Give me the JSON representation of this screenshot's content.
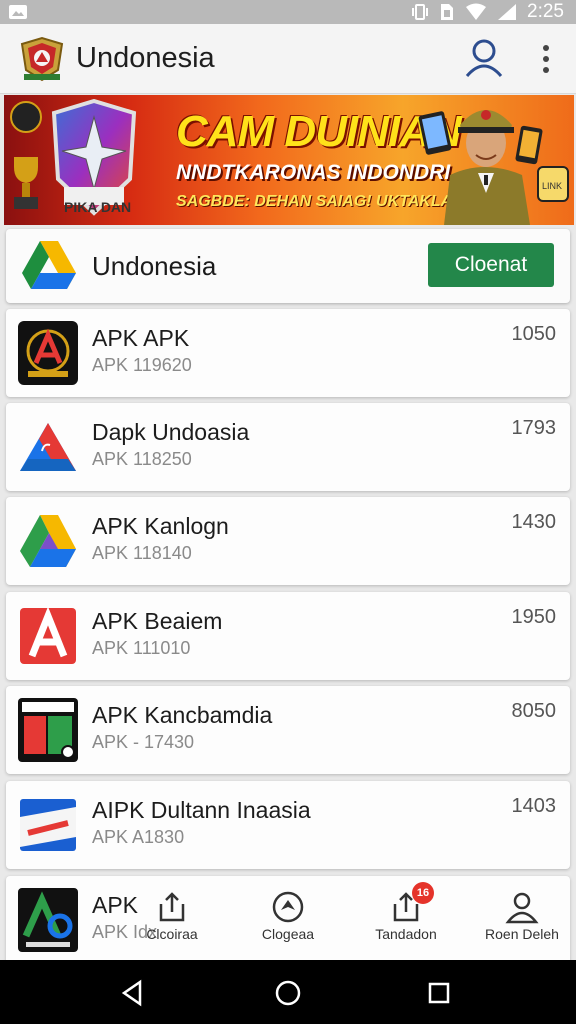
{
  "status_bar": {
    "time": "2:25",
    "icons": [
      "image-icon",
      "vibrate-icon",
      "sim-icon",
      "wifi-icon",
      "signal-icon"
    ]
  },
  "app_bar": {
    "title": "Undonesia",
    "icons": [
      "app-logo-icon",
      "account-icon",
      "more-vert-icon"
    ]
  },
  "banner": {
    "headline": "CAM DUINIAN",
    "subline": "NNDTKARONAS INDONDRI",
    "tagline": "SAGBDE: DEHAN SAIAG! UKTAKLANS",
    "shield_text": "PIKA DAN"
  },
  "featured": {
    "name": "Undonesia",
    "button_label": "Cloenat",
    "button_color": "#23874a"
  },
  "apps": [
    {
      "name": "APK APK",
      "subtitle": "APK 119620",
      "count": "1050",
      "icon": "black-gold-a-emblem-icon"
    },
    {
      "name": "Dapk Undoasia",
      "subtitle": "APK 118250",
      "count": "1793",
      "icon": "blue-red-triangle-icon"
    },
    {
      "name": "APK Kanlogn",
      "subtitle": "APK 118140",
      "count": "1430",
      "icon": "drive-triangle-icon"
    },
    {
      "name": "APK Beaiem",
      "subtitle": "APK 111010",
      "count": "1950",
      "icon": "red-a-letter-icon"
    },
    {
      "name": "APK Kancbamdia",
      "subtitle": "APK - 17430",
      "count": "8050",
      "icon": "green-94-badge-icon"
    },
    {
      "name": "AIPK Dultann Inaasia",
      "subtitle": "APK A1830",
      "count": "1403",
      "icon": "blue-ticket-icon"
    },
    {
      "name": "APK",
      "subtitle": "APK Idx",
      "count": "",
      "icon": "green-blue-a-emblem-icon"
    }
  ],
  "bottom_nav": [
    {
      "label": "Clcoiraa",
      "icon": "share-upload-icon",
      "badge": ""
    },
    {
      "label": "Clogeaa",
      "icon": "compass-icon",
      "badge": ""
    },
    {
      "label": "Tandadon",
      "icon": "share-upload-icon",
      "badge": "16"
    },
    {
      "label": "Roen Deleh",
      "icon": "person-icon",
      "badge": ""
    }
  ],
  "system_nav": [
    "back-icon",
    "home-icon",
    "recents-icon"
  ]
}
